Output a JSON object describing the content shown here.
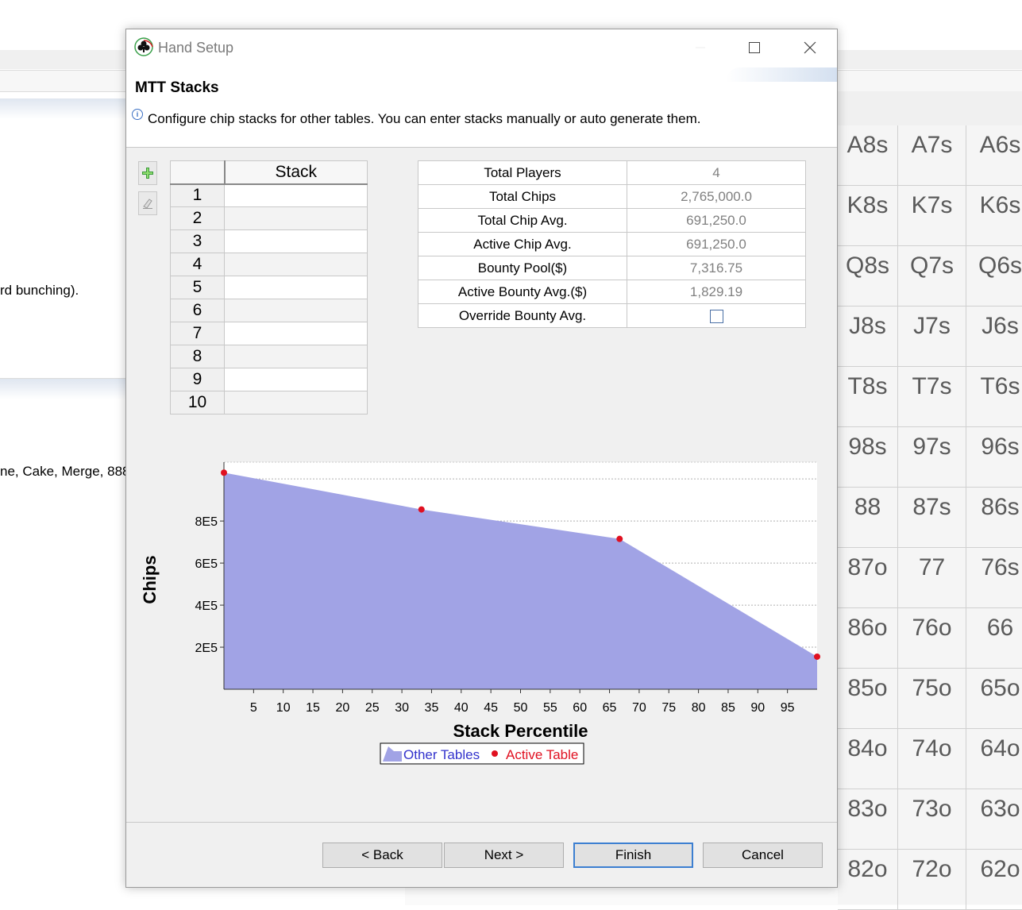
{
  "background": {
    "fragments": [
      "rd bunching).",
      "ne, Cake, Merge, 888"
    ],
    "hand_grid": [
      [
        "A8s",
        "A7s",
        "A6s"
      ],
      [
        "K8s",
        "K7s",
        "K6s"
      ],
      [
        "Q8s",
        "Q7s",
        "Q6s"
      ],
      [
        "J8s",
        "J7s",
        "J6s"
      ],
      [
        "T8s",
        "T7s",
        "T6s"
      ],
      [
        "98s",
        "97s",
        "96s"
      ],
      [
        "88",
        "87s",
        "86s"
      ],
      [
        "87o",
        "77",
        "76s"
      ],
      [
        "86o",
        "76o",
        "66"
      ],
      [
        "85o",
        "75o",
        "65o"
      ],
      [
        "84o",
        "74o",
        "64o"
      ],
      [
        "83o",
        "73o",
        "63o"
      ],
      [
        "82o",
        "72o",
        "62o"
      ]
    ]
  },
  "dialog": {
    "title": "Hand Setup",
    "page_title": "MTT Stacks",
    "description": "Configure chip stacks for other tables. You can enter stacks manually or auto generate them.",
    "tools": {
      "add_icon": "add-icon",
      "edit_icon": "eraser-icon"
    }
  },
  "stack_table": {
    "header": "Stack",
    "rows": [
      "1",
      "2",
      "3",
      "4",
      "5",
      "6",
      "7",
      "8",
      "9",
      "10"
    ]
  },
  "summary": {
    "rows": [
      {
        "label": "Total Players",
        "value": "4"
      },
      {
        "label": "Total Chips",
        "value": "2,765,000.0"
      },
      {
        "label": "Total Chip Avg.",
        "value": "691,250.0"
      },
      {
        "label": "Active Chip Avg.",
        "value": "691,250.0"
      },
      {
        "label": "Bounty Pool($)",
        "value": "7,316.75"
      },
      {
        "label": "Active Bounty Avg.($)",
        "value": "1,829.19"
      },
      {
        "label": "Override Bounty Avg.",
        "value": ""
      }
    ],
    "override_checked": false
  },
  "chart_data": {
    "type": "area",
    "xlabel": "Stack Percentile",
    "ylabel": "Chips",
    "xlim": [
      0,
      100
    ],
    "ylim": [
      0,
      1080000
    ],
    "x_ticks": [
      5,
      10,
      15,
      20,
      25,
      30,
      35,
      40,
      45,
      50,
      55,
      60,
      65,
      70,
      75,
      80,
      85,
      90,
      95
    ],
    "y_ticks": [
      {
        "value": 200000,
        "label": "2E5"
      },
      {
        "value": 400000,
        "label": "4E5"
      },
      {
        "value": 600000,
        "label": "6E5"
      },
      {
        "value": 800000,
        "label": "8E5"
      }
    ],
    "grid": true,
    "legend_position": "bottom",
    "series": [
      {
        "name": "Other Tables",
        "kind": "area",
        "color": "#a1a3e5",
        "x": [
          0,
          33.3,
          66.7,
          100
        ],
        "y": [
          1030000,
          855000,
          715000,
          155000
        ]
      },
      {
        "name": "Active Table",
        "kind": "points",
        "color": "#e01020",
        "x": [
          0,
          33.3,
          66.7,
          100
        ],
        "y": [
          1030000,
          855000,
          715000,
          155000
        ]
      }
    ]
  },
  "buttons": {
    "back": "< Back",
    "next": "Next >",
    "finish": "Finish",
    "cancel": "Cancel"
  },
  "colors": {
    "legend_other": "#3333cc",
    "legend_active": "#e01020"
  }
}
